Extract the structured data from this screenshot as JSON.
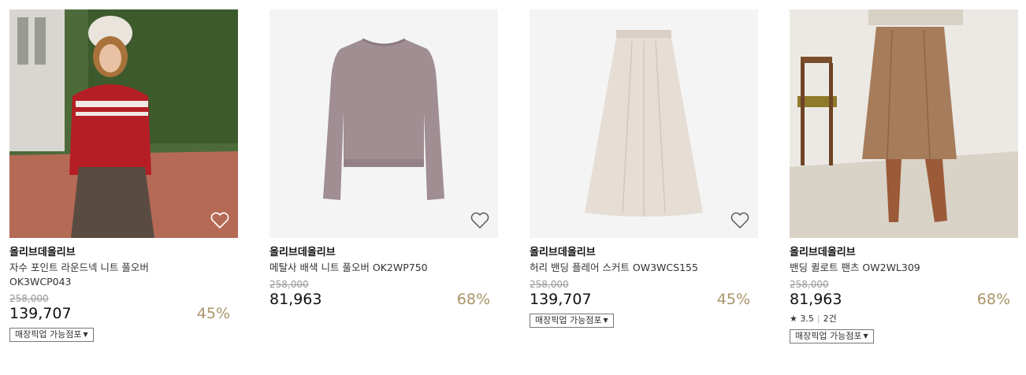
{
  "products": [
    {
      "brand": "올리브데올리브",
      "name_line1": "자수 포인트 라운드넥 니트 풀오버",
      "name_line2": "OK3WCP043",
      "original_price": "258,000",
      "price": "139,707",
      "discount": "45%",
      "pickup_label": "매장픽업 가능점포",
      "pickup_caret": "▼",
      "heart_icon": "heart-outline-icon"
    },
    {
      "brand": "올리브데올리브",
      "name_line1": "메탈사 배색 니트 풀오버 OK2WP750",
      "original_price": "258,000",
      "price": "81,963",
      "discount": "68%",
      "heart_icon": "heart-outline-icon"
    },
    {
      "brand": "올리브데올리브",
      "name_line1": "허리 밴딩 플레어 스커트 OW3WCS155",
      "original_price": "258,000",
      "price": "139,707",
      "discount": "45%",
      "pickup_label": "매장픽업 가능점포",
      "pickup_caret": "▼",
      "heart_icon": "heart-outline-icon"
    },
    {
      "brand": "올리브데올리브",
      "name_line1": "밴딩 퀼로트 팬츠 OW2WL309",
      "original_price": "258,000",
      "price": "81,963",
      "discount": "68%",
      "rating_star": "★",
      "rating": "3.5",
      "review_count": "2건",
      "pickup_label": "매장픽업 가능점포",
      "pickup_caret": "▼"
    }
  ],
  "colors": {
    "discount": "#a8946a",
    "strike": "#999999"
  }
}
